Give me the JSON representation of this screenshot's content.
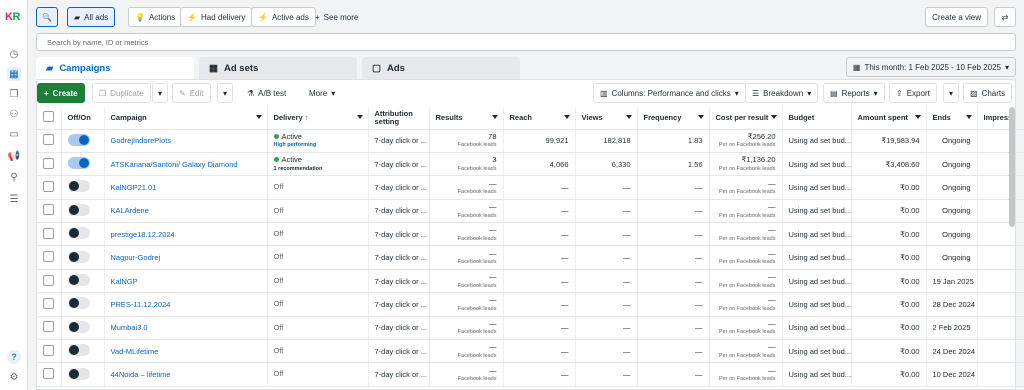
{
  "brand": {
    "logo_k": "K",
    "logo_r": "R"
  },
  "topbar": {
    "all_ads": "All ads",
    "actions": "Actions",
    "had_delivery": "Had delivery",
    "active_ads": "Active ads",
    "see_more": "See more",
    "create_view": "Create a view"
  },
  "search": {
    "placeholder": "Search by name, ID or metrics"
  },
  "tabs": {
    "campaigns": "Campaigns",
    "ad_sets": "Ad sets",
    "ads": "Ads"
  },
  "date_range": "This month: 1 Feb 2025 - 10 Feb 2025",
  "toolbar": {
    "create": "Create",
    "duplicate": "Duplicate",
    "edit": "Edit",
    "ab_test": "A/B test",
    "more": "More",
    "columns": "Columns: Performance and clicks",
    "breakdown": "Breakdown",
    "reports": "Reports",
    "export": "Export",
    "charts": "Charts"
  },
  "columns": [
    "Off/On",
    "Campaign",
    "Delivery",
    "Attribution setting",
    "Results",
    "Reach",
    "Views",
    "Frequency",
    "Cost per result",
    "Budget",
    "Amount spent",
    "Ends",
    "Impress"
  ],
  "rows": [
    {
      "on": true,
      "campaign": "GodrejIndorePlots",
      "delivery": "Active",
      "delivery_sub": "High performing",
      "attribution": "7-day click or ...",
      "results": "78",
      "results_sub": "Facebook leads",
      "reach": "99,921",
      "views": "182,818",
      "frequency": "1.83",
      "cpr": "₹256.20",
      "cpr_sub": "Per on Facebook leads",
      "budget": "Using ad set bud...",
      "spent": "₹19,983.94",
      "ends": "Ongoing"
    },
    {
      "on": true,
      "campaign": "ATSKanana/Santoni/ Galaxy Diamond",
      "delivery": "Active",
      "delivery_sub": "1 recommendation",
      "attribution": "7-day click or ...",
      "results": "3",
      "results_sub": "Facebook leads",
      "reach": "4,066",
      "views": "6,330",
      "frequency": "1.56",
      "cpr": "₹1,136.20",
      "cpr_sub": "Per on Facebook leads",
      "budget": "Using ad set bud...",
      "spent": "₹3,408.60",
      "ends": "Ongoing"
    },
    {
      "on": false,
      "campaign": "KalNGP21.01",
      "delivery": "Off",
      "delivery_sub": "",
      "attribution": "7-day click or ...",
      "results": "—",
      "results_sub": "Facebook leads",
      "reach": "—",
      "views": "—",
      "frequency": "—",
      "cpr": "—",
      "cpr_sub": "Per on Facebook leads",
      "budget": "Using ad set bud...",
      "spent": "₹0.00",
      "ends": "Ongoing"
    },
    {
      "on": false,
      "campaign": "KALArdene",
      "delivery": "Off",
      "delivery_sub": "",
      "attribution": "7-day click or ...",
      "results": "—",
      "results_sub": "Facebook leads",
      "reach": "—",
      "views": "—",
      "frequency": "—",
      "cpr": "—",
      "cpr_sub": "Per on Facebook leads",
      "budget": "Using ad set bud...",
      "spent": "₹0.00",
      "ends": "Ongoing"
    },
    {
      "on": false,
      "campaign": "prestige18.12.2024",
      "delivery": "Off",
      "delivery_sub": "",
      "attribution": "7-day click or ...",
      "results": "—",
      "results_sub": "Facebook leads",
      "reach": "—",
      "views": "—",
      "frequency": "—",
      "cpr": "—",
      "cpr_sub": "Per on Facebook leads",
      "budget": "Using ad set bud...",
      "spent": "₹0.00",
      "ends": "Ongoing"
    },
    {
      "on": false,
      "campaign": "Nagpur-Godrej",
      "delivery": "Off",
      "delivery_sub": "",
      "attribution": "7-day click or ...",
      "results": "—",
      "results_sub": "Facebook leads",
      "reach": "—",
      "views": "—",
      "frequency": "—",
      "cpr": "—",
      "cpr_sub": "Per on Facebook leads",
      "budget": "Using ad set bud...",
      "spent": "₹0.00",
      "ends": "Ongoing"
    },
    {
      "on": false,
      "campaign": "KalNGP",
      "delivery": "Off",
      "delivery_sub": "",
      "attribution": "7-day click or ...",
      "results": "—",
      "results_sub": "Facebook leads",
      "reach": "—",
      "views": "—",
      "frequency": "—",
      "cpr": "—",
      "cpr_sub": "Per on Facebook leads",
      "budget": "Using ad set bud...",
      "spent": "₹0.00",
      "ends": "19 Jan 2025"
    },
    {
      "on": false,
      "campaign": "PRES-11.12.2024",
      "delivery": "Off",
      "delivery_sub": "",
      "attribution": "7-day click or ...",
      "results": "—",
      "results_sub": "Facebook leads",
      "reach": "—",
      "views": "—",
      "frequency": "—",
      "cpr": "—",
      "cpr_sub": "Per on Facebook leads",
      "budget": "Using ad set bud...",
      "spent": "₹0.00",
      "ends": "28 Dec 2024"
    },
    {
      "on": false,
      "campaign": "Mumbai3.0",
      "delivery": "Off",
      "delivery_sub": "",
      "attribution": "7-day click or ...",
      "results": "—",
      "results_sub": "Facebook leads",
      "reach": "—",
      "views": "—",
      "frequency": "—",
      "cpr": "—",
      "cpr_sub": "Per on Facebook leads",
      "budget": "Using ad set bud...",
      "spent": "₹0.00",
      "ends": "2 Feb 2025"
    },
    {
      "on": false,
      "campaign": "Vad-MLifetime",
      "delivery": "Off",
      "delivery_sub": "",
      "attribution": "7-day click or ...",
      "results": "—",
      "results_sub": "Facebook leads",
      "reach": "—",
      "views": "—",
      "frequency": "—",
      "cpr": "—",
      "cpr_sub": "Per on Facebook leads",
      "budget": "Using ad set bud...",
      "spent": "₹0.00",
      "ends": "24 Dec 2024"
    },
    {
      "on": false,
      "campaign": "44Noida – lifetime",
      "delivery": "Off",
      "delivery_sub": "",
      "attribution": "7-day click or ...",
      "results": "—",
      "results_sub": "Facebook leads",
      "reach": "—",
      "views": "—",
      "frequency": "—",
      "cpr": "—",
      "cpr_sub": "Per on Facebook leads",
      "budget": "Using ad set bud...",
      "spent": "₹0.00",
      "ends": "10 Dec 2024"
    }
  ]
}
